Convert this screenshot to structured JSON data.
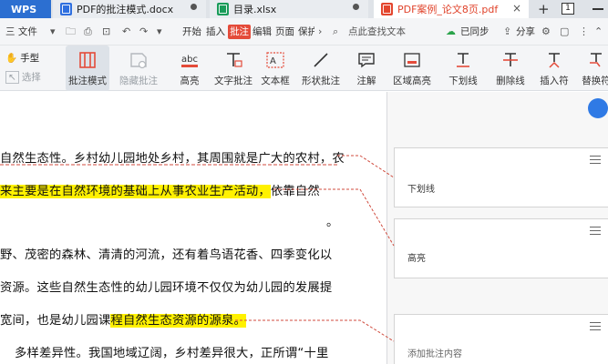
{
  "tabs": {
    "wps": "WPS",
    "doc": "PDF的批注模式.docx",
    "xlsx": "目录.xlsx",
    "pdf": "PDF案例_论文8页.pdf",
    "win_box": "1"
  },
  "menu": {
    "file": "三 文件",
    "start": "开始",
    "insert": "插入",
    "annotate": "批注",
    "edit": "编辑",
    "page": "页面",
    "protect": "保护",
    "search": "点此查找文本",
    "sync": "已同步",
    "share": "分享"
  },
  "ribbon": {
    "hand": "手型",
    "select": "选择",
    "annot_mode": "批注模式",
    "hide_annot": "隐藏批注",
    "highlight": "高亮",
    "text_annot": "文字批注",
    "textbox": "文本框",
    "shape_annot": "形状批注",
    "note": "注解",
    "area_highlight": "区域高亮",
    "underline": "下划线",
    "strikeout": "删除线",
    "insert_symbol": "插入符",
    "replace_symbol": "替换符"
  },
  "doc": {
    "lines": [
      {
        "pre": "",
        "hl": "",
        "text": "自然生态性。乡村幼儿园地处乡村，其周围就是广大的农村，农"
      },
      {
        "pre": "",
        "hl": "来主要是在自然环境的基础上从事农业生产活动，",
        "text": "依靠自然"
      },
      {
        "pre": "",
        "hl": "",
        "text": "。"
      },
      {
        "pre": "",
        "hl": "",
        "text": "野、茂密的森林、清清的河流，还有着鸟语花香、四季变化以"
      },
      {
        "pre": "",
        "hl": "",
        "text": "资源。这些自然生态性的幼儿园环境不仅仅为幼儿园的发展提"
      },
      {
        "pre": "宽间，也是幼儿园课",
        "hl": "程自然生态资源的源泉。",
        "text": ""
      },
      {
        "pre": "",
        "hl": "",
        "text": "多样差异性。我国地域辽阔，乡村差异很大，正所谓“十里"
      }
    ]
  },
  "comments": [
    {
      "text": "下划线"
    },
    {
      "text": "高亮"
    },
    {
      "text": "添加批注内容"
    }
  ],
  "colors": {
    "accent": "#2c6fd1",
    "annotate_tab": "#e44b3a",
    "highlight": "#fff100",
    "leader_line": "#d04b3e"
  }
}
